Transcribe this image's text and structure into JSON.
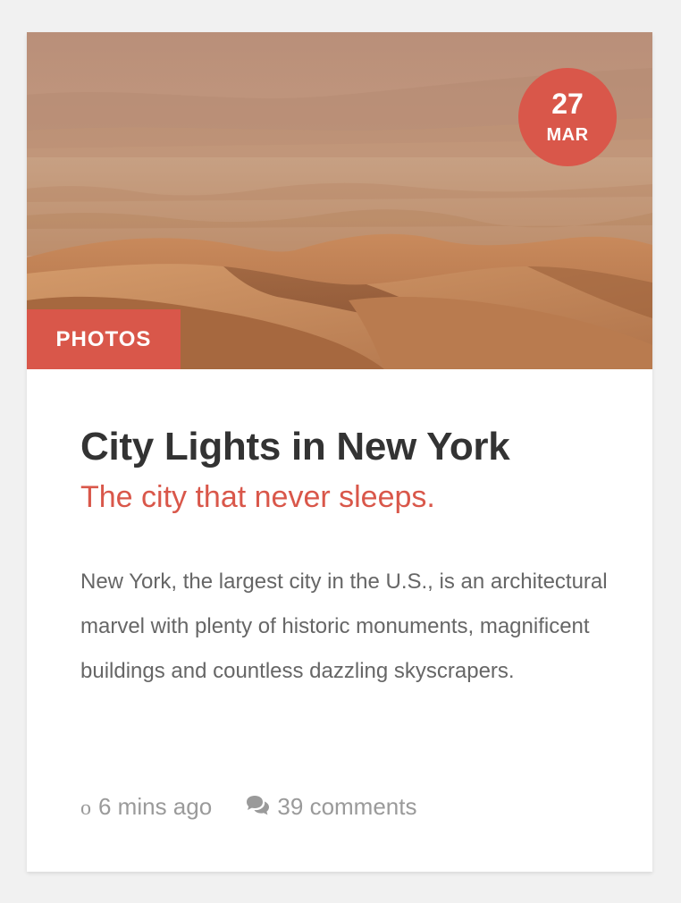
{
  "colors": {
    "accent": "#d9574a",
    "title": "#333333",
    "body_text": "#666666",
    "meta_text": "#9a9a9a",
    "card_bg": "#ffffff",
    "page_bg": "#f1f1f1"
  },
  "post": {
    "image_alt": "Desert sand dunes",
    "date": {
      "day": "27",
      "month": "MAR"
    },
    "category": "PHOTOS",
    "title": "City Lights in New York",
    "subtitle": "The city that never sleeps.",
    "excerpt": "New York, the largest city in the U.S., is an architectural marvel with plenty of historic monuments, magnificent buildings and countless dazzling skyscrapers.",
    "meta": {
      "time_icon": "clock-icon",
      "time_icon_glyph": "o",
      "time_ago": "6 mins ago",
      "comments_icon": "comments-icon",
      "comments": "39 comments"
    }
  }
}
